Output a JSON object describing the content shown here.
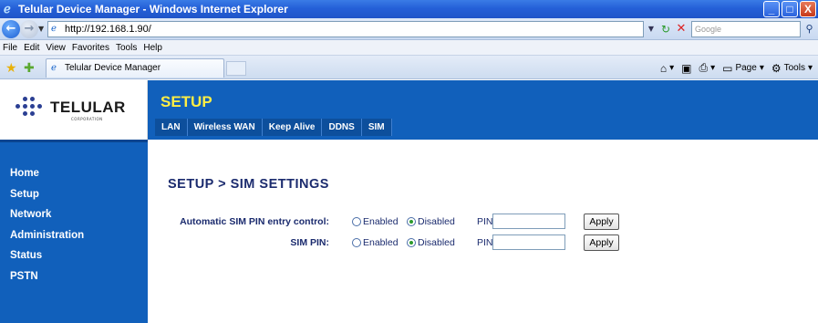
{
  "window": {
    "title": "Telular Device Manager - Windows Internet Explorer",
    "controls": [
      "_",
      "□",
      "X"
    ]
  },
  "address_bar": {
    "url": "http://192.168.1.90/",
    "search_placeholder": "Google"
  },
  "menu": [
    "File",
    "Edit",
    "View",
    "Favorites",
    "Tools",
    "Help"
  ],
  "tab": {
    "title": "Telular Device Manager"
  },
  "command_bar": {
    "page_label": "Page",
    "tools_label": "Tools"
  },
  "logo": {
    "name": "TELULAR",
    "sub": "CORPORATION"
  },
  "header": {
    "title": "SETUP",
    "subnav": [
      "LAN",
      "Wireless WAN",
      "Keep Alive",
      "DDNS",
      "SIM"
    ]
  },
  "sidebar": [
    "Home",
    "Setup",
    "Network",
    "Administration",
    "Status",
    "PSTN"
  ],
  "main": {
    "title": "SETUP > SIM SETTINGS",
    "rows": [
      {
        "label": "Automatic SIM PIN entry control:",
        "enabled": "Enabled",
        "disabled": "Disabled",
        "pin": "PIN:",
        "pin_value": "",
        "apply": "Apply",
        "selected": "Disabled"
      },
      {
        "label": "SIM PIN:",
        "enabled": "Enabled",
        "disabled": "Disabled",
        "pin": "PIN:",
        "pin_value": "",
        "apply": "Apply",
        "selected": "Disabled"
      }
    ]
  },
  "colors": {
    "nav_blue": "#1160bb",
    "title_yellow": "#ffee44",
    "heading_navy": "#1b2b6e"
  }
}
